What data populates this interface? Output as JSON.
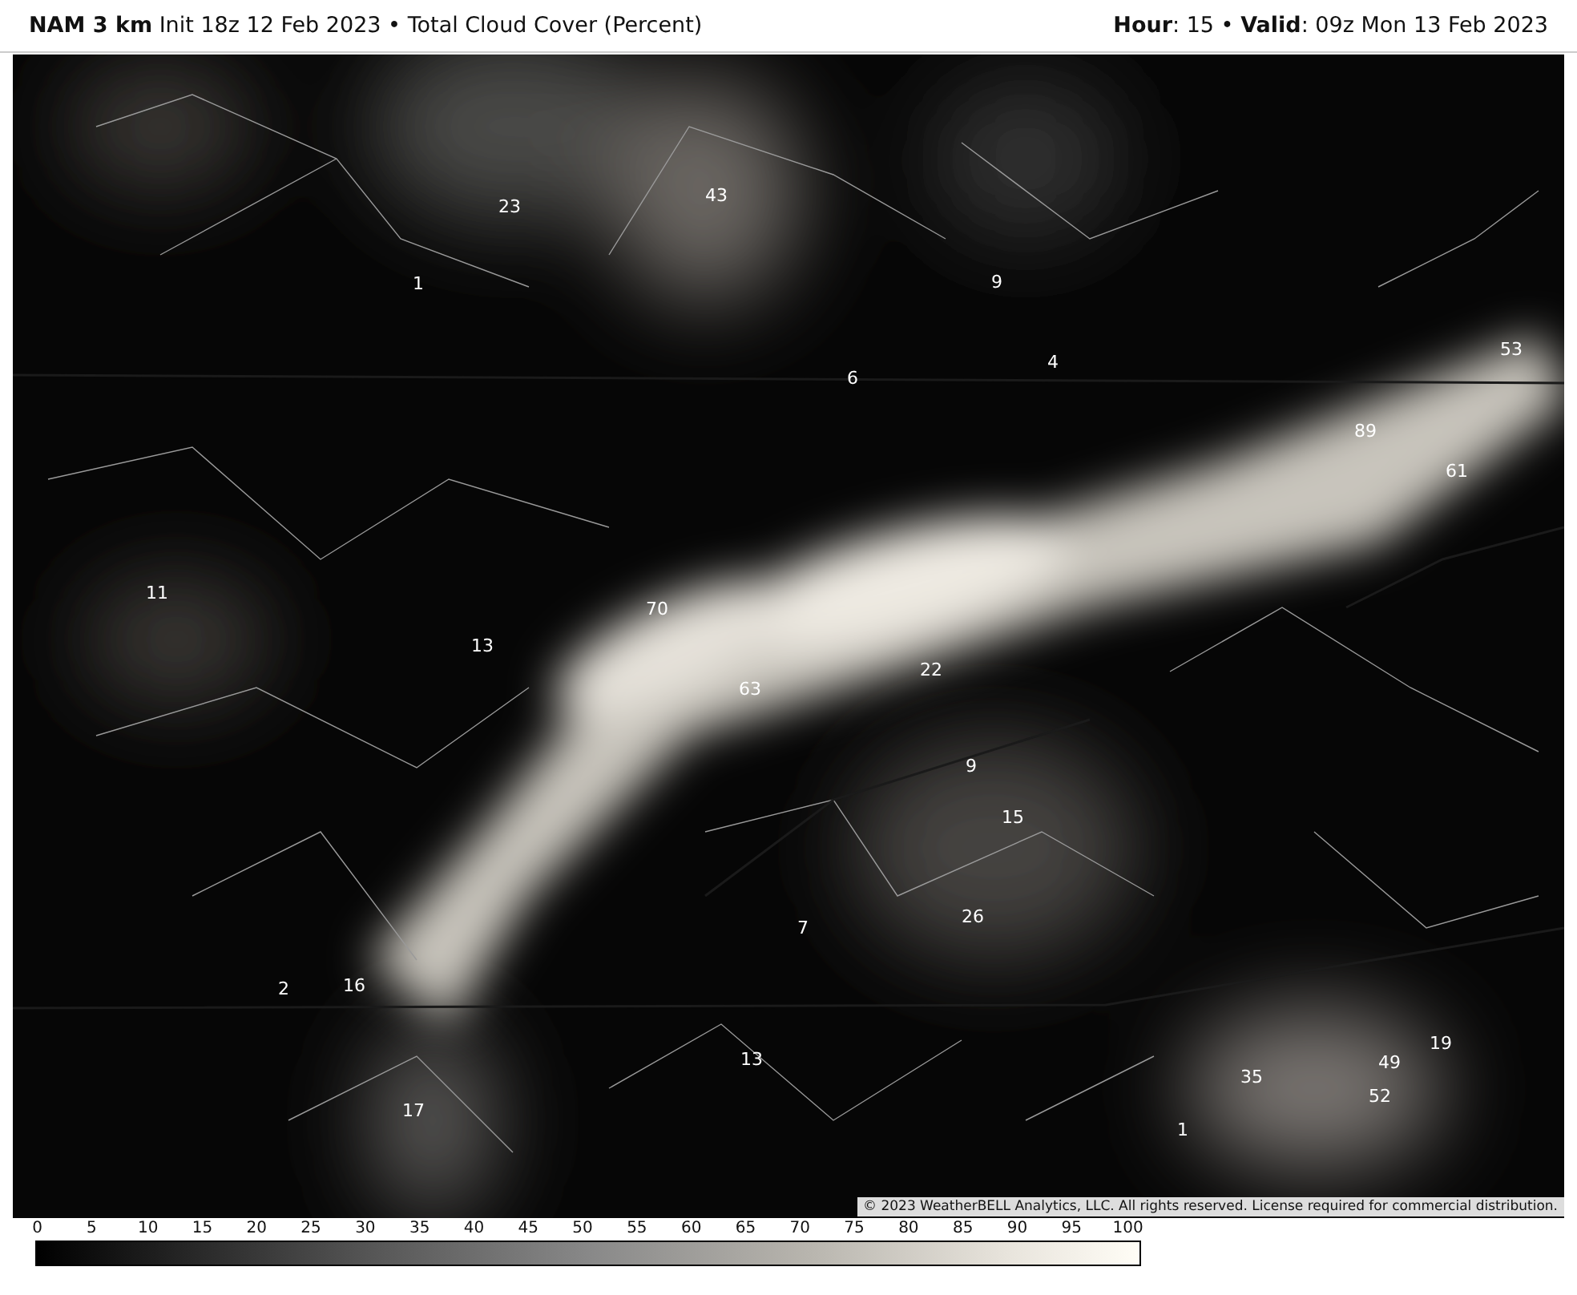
{
  "header": {
    "left": "**NAM 3 km** Init 18z 12 Feb 2023 • Total Cloud Cover (Percent)",
    "right": "**Hour**: 15 • **Valid**: 09z Mon 13 Feb 2023"
  },
  "map": {
    "values": [
      "23",
      "43",
      "1",
      "9",
      "6",
      "4",
      "53",
      "89",
      "61",
      "11",
      "70",
      "13",
      "63",
      "22",
      "9",
      "15",
      "7",
      "26",
      "2",
      "16",
      "13",
      "17",
      "35",
      "49",
      "19",
      "52",
      "1"
    ],
    "copyright": "© 2023 WeatherBELL Analytics, LLC. All rights reserved. License required for commercial distribution."
  },
  "colorbar": {
    "ticks": [
      "0",
      "5",
      "10",
      "15",
      "20",
      "25",
      "30",
      "35",
      "40",
      "45",
      "50",
      "55",
      "60",
      "65",
      "70",
      "75",
      "80",
      "85",
      "90",
      "95",
      "100"
    ]
  }
}
